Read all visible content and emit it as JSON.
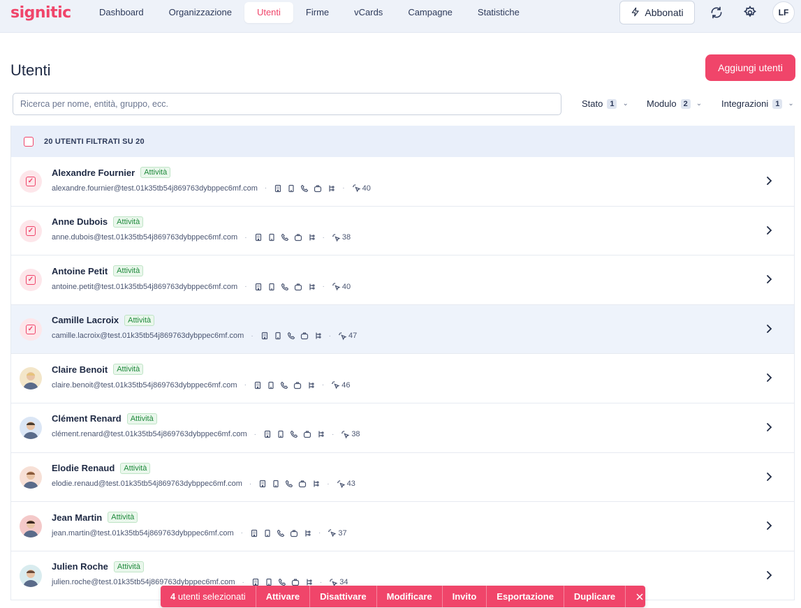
{
  "brand": {
    "name": "signitic",
    "color": "#f0456a"
  },
  "nav": {
    "items": [
      {
        "label": "Dashboard"
      },
      {
        "label": "Organizzazione"
      },
      {
        "label": "Utenti",
        "active": true
      },
      {
        "label": "Firme"
      },
      {
        "label": "vCards"
      },
      {
        "label": "Campagne"
      },
      {
        "label": "Statistiche"
      }
    ],
    "subscribe_label": "Abbonati",
    "avatar_initials": "LF"
  },
  "page": {
    "title": "Utenti",
    "add_button_label": "Aggiungi utenti",
    "search_placeholder": "Ricerca per nome, entità, gruppo, ecc."
  },
  "filters": [
    {
      "label": "Stato",
      "count": "1"
    },
    {
      "label": "Modulo",
      "count": "2"
    },
    {
      "label": "Integrazioni",
      "count": "1"
    }
  ],
  "table": {
    "header_count": "20",
    "header_text": "UTENTI FILTRATI SU",
    "header_total": "20",
    "rows": [
      {
        "name": "Alexandre Fournier",
        "status": "Attività",
        "email": "alexandre.fournier@test.01k35tb54j869763dybppec6mf.com",
        "views": "40",
        "selected": true
      },
      {
        "name": "Anne Dubois",
        "status": "Attività",
        "email": "anne.dubois@test.01k35tb54j869763dybppec6mf.com",
        "views": "38",
        "selected": true
      },
      {
        "name": "Antoine Petit",
        "status": "Attività",
        "email": "antoine.petit@test.01k35tb54j869763dybppec6mf.com",
        "views": "40",
        "selected": true
      },
      {
        "name": "Camille Lacroix",
        "status": "Attività",
        "email": "camille.lacroix@test.01k35tb54j869763dybppec6mf.com",
        "views": "47",
        "selected": true
      },
      {
        "name": "Claire Benoit",
        "status": "Attività",
        "email": "claire.benoit@test.01k35tb54j869763dybppec6mf.com",
        "views": "46",
        "selected": false
      },
      {
        "name": "Clément Renard",
        "status": "Attività",
        "email": "clément.renard@test.01k35tb54j869763dybppec6mf.com",
        "views": "38",
        "selected": false
      },
      {
        "name": "Elodie Renaud",
        "status": "Attività",
        "email": "elodie.renaud@test.01k35tb54j869763dybppec6mf.com",
        "views": "43",
        "selected": false
      },
      {
        "name": "Jean Martin",
        "status": "Attività",
        "email": "jean.martin@test.01k35tb54j869763dybppec6mf.com",
        "views": "37",
        "selected": false
      },
      {
        "name": "Julien Roche",
        "status": "Attività",
        "email": "julien.roche@test.01k35tb54j869763dybppec6mf.com",
        "views": "34",
        "selected": false
      }
    ]
  },
  "actionbar": {
    "selected_count": "4",
    "selected_label": "utenti selezionati",
    "actions": [
      "Attivare",
      "Disattivare",
      "Modificare",
      "Invito",
      "Esportazione",
      "Duplicare"
    ]
  }
}
